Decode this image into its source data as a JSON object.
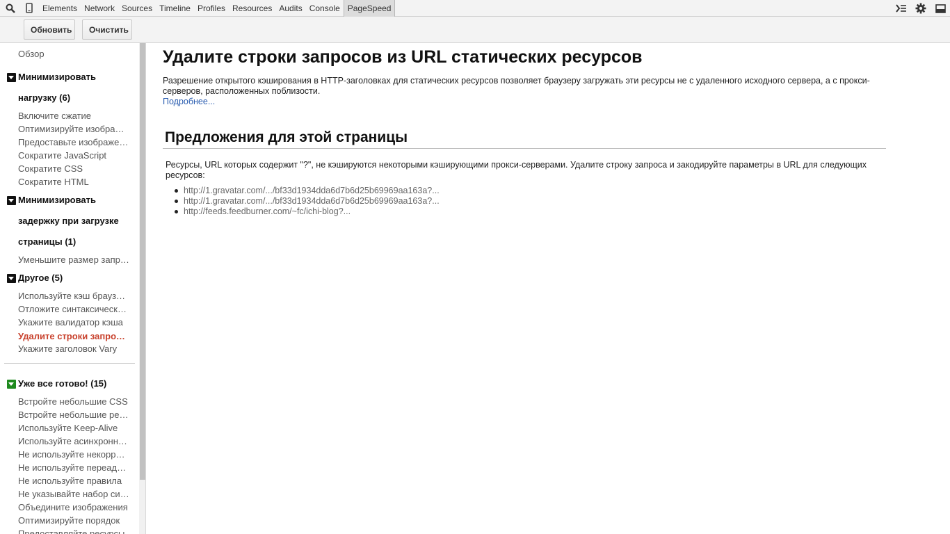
{
  "tabbar": {
    "tabs": [
      {
        "label": "Elements"
      },
      {
        "label": "Network"
      },
      {
        "label": "Sources"
      },
      {
        "label": "Timeline"
      },
      {
        "label": "Profiles"
      },
      {
        "label": "Resources"
      },
      {
        "label": "Audits"
      },
      {
        "label": "Console"
      },
      {
        "label": "PageSpeed",
        "active": true
      }
    ],
    "icons": [
      "search-icon",
      "device-mode-icon",
      "console-drawer-icon",
      "gear-icon",
      "dock-icon"
    ]
  },
  "toolbar": {
    "refresh_label": "Обновить",
    "clear_label": "Очистить"
  },
  "sidebar": {
    "overview": "Обзор",
    "categories": [
      {
        "title_lines": [
          "Минимизировать",
          "нагрузку (6)"
        ],
        "items": [
          "Включите сжатие",
          "Оптимизируйте изображения",
          "Предоставьте изображения",
          "Сократите JavaScript",
          "Сократите CSS",
          "Сократите HTML"
        ]
      },
      {
        "title_lines": [
          "Минимизировать",
          "задержку при загрузке",
          "страницы (1)"
        ],
        "items": [
          "Уменьшите размер запроса"
        ]
      },
      {
        "title_lines": [
          "Другое (5)"
        ],
        "items": [
          "Используйте кэш браузера",
          "Отложите синтаксический анализ",
          "Укажите валидатор кэша",
          "Удалите строки запросов",
          "Укажите заголовок Vary"
        ],
        "active_index": 3
      },
      {
        "title_lines": [
          "Уже все готово! (15)"
        ],
        "items": [
          "Встройте небольшие CSS",
          "Встройте небольшие ресурсы",
          "Используйте Keep-Alive",
          "Используйте асинхронные",
          "Не используйте некорректные",
          "Не используйте переадресации",
          "Не используйте правила",
          "Не указывайте набор символов",
          "Объедините изображения",
          "Оптимизируйте порядок",
          "Предоставляйте ресурсы"
        ]
      }
    ]
  },
  "main": {
    "title": "Удалите строки запросов из URL статических ресурсов",
    "description": "Разрешение открытого кэширования в HTTP-заголовках для статических ресурсов позволяет браузеру загружать эти ресурсы не с удаленного исходного сервера, а с прокси-серверов, расположенных поблизости.",
    "more_link": "Подробнее...",
    "suggestions_title": "Предложения для этой страницы",
    "suggestions_text": "Ресурсы, URL которых содержит \"?\", не кэшируются некоторыми кэширующими прокси-серверами. Удалите строку запроса и закодируйте параметры в URL для следующих ресурсов:",
    "urls": [
      "http://1.gravatar.com/.../bf33d1934dda6d7b6d25b69969aa163a?...",
      "http://1.gravatar.com/.../bf33d1934dda6d7b6d25b69969aa163a?...",
      "http://feeds.feedburner.com/~fc/ichi-blog?..."
    ]
  }
}
